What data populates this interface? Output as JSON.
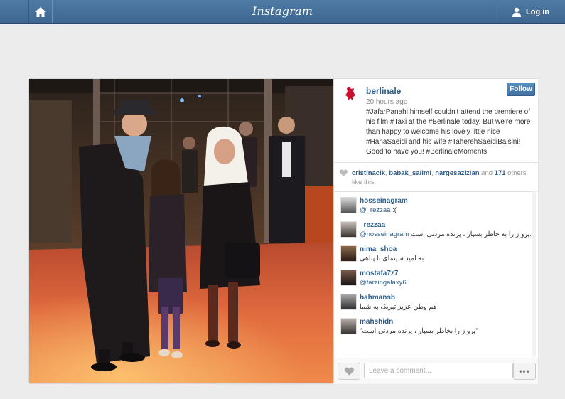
{
  "topbar": {
    "logo": "Instagram",
    "login_label": "Log in"
  },
  "post": {
    "username": "berlinale",
    "timestamp": "20 hours ago",
    "follow_label": "Follow",
    "caption": "#JafarPanahi himself couldn't attend the premiere of his film #Taxi at the #Berlinale today. But we're more than happy to welcome his lovely little nice #HanaSaeidi and his wife #TaherehSaeidiBalsini! Good to have you! #BerlinaleMoments",
    "likes": {
      "user1": "cristinacik",
      "sep1": ", ",
      "user2": "babak_salimi",
      "sep2": ", ",
      "user3": "nargesazizian",
      "and": " and ",
      "count": "171",
      "rest": " others like this."
    }
  },
  "comments": [
    {
      "user": "hosseinagram",
      "mention": "@_rezzaa",
      "text": " :("
    },
    {
      "user": "_rezzaa",
      "mention": "@hosseinagram",
      "text": " پرواز را به خاطر بسپار ، پرنده مردنی است..."
    },
    {
      "user": "nima_shoa",
      "mention": "",
      "text": "به امید سینمای با پناهی"
    },
    {
      "user": "mostafa7z7",
      "mention": "@farzingalaxy6",
      "text": ""
    },
    {
      "user": "bahmansb",
      "mention": "",
      "text": "هم وطن عزیز تبریک به شما"
    },
    {
      "user": "mahshidn",
      "mention": "",
      "text": "\"پرواز را بخاطر بسپار ، پرنده مردنی است\""
    }
  ],
  "footer": {
    "comment_placeholder": "Leave a comment..."
  },
  "colors": {
    "topbar": "#4a76a0",
    "link": "#2c5d8a",
    "follow": "#4a7fb5",
    "carpet": "#d0573a"
  }
}
